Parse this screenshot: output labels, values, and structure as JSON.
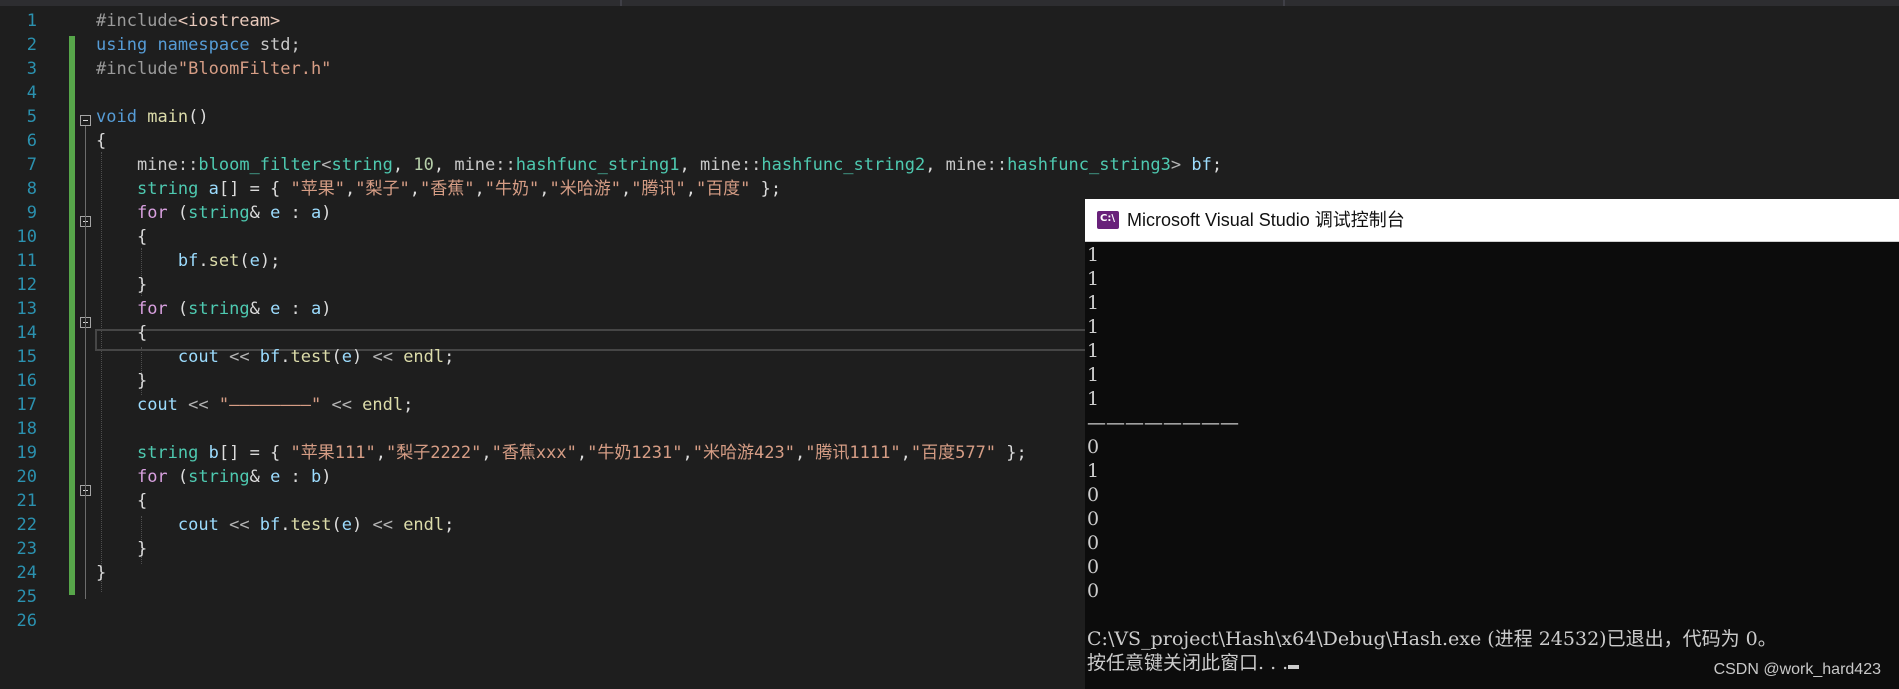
{
  "editor": {
    "line_numbers": [
      "1",
      "2",
      "3",
      "4",
      "5",
      "6",
      "7",
      "8",
      "9",
      "10",
      "11",
      "12",
      "13",
      "14",
      "15",
      "16",
      "17",
      "18",
      "19",
      "20",
      "21",
      "22",
      "23",
      "24",
      "25",
      "26"
    ],
    "code": {
      "l1_pp": "#include",
      "l1_inc": "<iostream>",
      "l2_using": "using",
      "l2_namespace": "namespace",
      "l2_std": "std;",
      "l3_pp": "#include",
      "l3_inc": "\"BloomFilter.h\"",
      "l5_void": "void",
      "l5_main": "main",
      "l5_parens": "()",
      "l6_brace": "{",
      "l7_ns1": "mine::",
      "l7_type": "bloom_filter",
      "l7_lt": "<",
      "l7_string": "string",
      "l7_comma1": ", ",
      "l7_num": "10",
      "l7_comma2": ", ",
      "l7_ns2": "mine::",
      "l7_h1": "hashfunc_string1",
      "l7_comma3": ", ",
      "l7_ns3": "mine::",
      "l7_h2": "hashfunc_string2",
      "l7_comma4": ", ",
      "l7_ns4": "mine::",
      "l7_h3": "hashfunc_string3",
      "l7_gt": "> ",
      "l7_var": "bf",
      "l7_semi": ";",
      "l8_type": "string",
      "l8_var": "a",
      "l8_rest": "[] = { ",
      "l8_s1": "\"苹果\"",
      "l8_s2": "\"梨子\"",
      "l8_s3": "\"香蕉\"",
      "l8_s4": "\"牛奶\"",
      "l8_s5": "\"米哈游\"",
      "l8_s6": "\"腾讯\"",
      "l8_s7": "\"百度\"",
      "l8_end": " };",
      "l9_for": "for",
      "l9_open": " (",
      "l9_type": "string",
      "l9_amp": "& ",
      "l9_e": "e",
      "l9_colon": " : ",
      "l9_a": "a",
      "l9_close": ")",
      "l10_brace": "{",
      "l11_bf": "bf",
      "l11_dot": ".",
      "l11_set": "set",
      "l11_open": "(",
      "l11_e": "e",
      "l11_close": ");",
      "l12_brace": "}",
      "l13_for": "for",
      "l13_open": " (",
      "l13_type": "string",
      "l13_amp": "& ",
      "l13_e": "e",
      "l13_colon": " : ",
      "l13_a": "a",
      "l13_close": ")",
      "l14_brace": "{",
      "l15_cout": "cout",
      "l15_op1": " << ",
      "l15_bf": "bf",
      "l15_dot": ".",
      "l15_test": "test",
      "l15_open": "(",
      "l15_e": "e",
      "l15_close": ")",
      "l15_op2": " << ",
      "l15_endl": "endl",
      "l15_semi": ";",
      "l16_brace": "}",
      "l17_cout": "cout",
      "l17_op1": " << ",
      "l17_str": "\"————————\"",
      "l17_op2": " << ",
      "l17_endl": "endl",
      "l17_semi": ";",
      "l19_type": "string",
      "l19_var": "b",
      "l19_rest": "[] = { ",
      "l19_s1": "\"苹果111\"",
      "l19_s2": "\"梨子2222\"",
      "l19_s3": "\"香蕉xxx\"",
      "l19_s4": "\"牛奶1231\"",
      "l19_s5": "\"米哈游423\"",
      "l19_s6": "\"腾讯1111\"",
      "l19_s7": "\"百度577\"",
      "l19_end": " };",
      "l20_for": "for",
      "l20_open": " (",
      "l20_type": "string",
      "l20_amp": "& ",
      "l20_e": "e",
      "l20_colon": " : ",
      "l20_b": "b",
      "l20_close": ")",
      "l21_brace": "{",
      "l22_cout": "cout",
      "l22_op1": " << ",
      "l22_bf": "bf",
      "l22_dot": ".",
      "l22_test": "test",
      "l22_open": "(",
      "l22_e": "e",
      "l22_close": ")",
      "l22_op2": " << ",
      "l22_endl": "endl",
      "l22_semi": ";",
      "l23_brace": "}",
      "l24_brace": "}"
    }
  },
  "console": {
    "title": "Microsoft Visual Studio 调试控制台",
    "icon": "console-app-icon",
    "icon_text": "C:\\",
    "output_lines": [
      "1",
      "1",
      "1",
      "1",
      "1",
      "1",
      "1",
      "————————",
      "0",
      "1",
      "0",
      "0",
      "0",
      "0",
      "0",
      "",
      "C:\\VS_project\\Hash\\x64\\Debug\\Hash.exe (进程 24532)已退出，代码为 0。",
      "按任意键关闭此窗口. . ."
    ]
  },
  "watermark": "CSDN @work_hard423",
  "colors": {
    "editor_bg": "#1e1e1e",
    "line_number": "#2b91af",
    "keyword": "#569cd6",
    "control_keyword": "#d8a0df",
    "string": "#d69d85",
    "type": "#4ec9b0",
    "function": "#dcdcaa",
    "variable": "#9cdcfe",
    "change_bar": "#57a64a",
    "console_bg": "#0c0c0c",
    "console_text": "#cccccc"
  }
}
